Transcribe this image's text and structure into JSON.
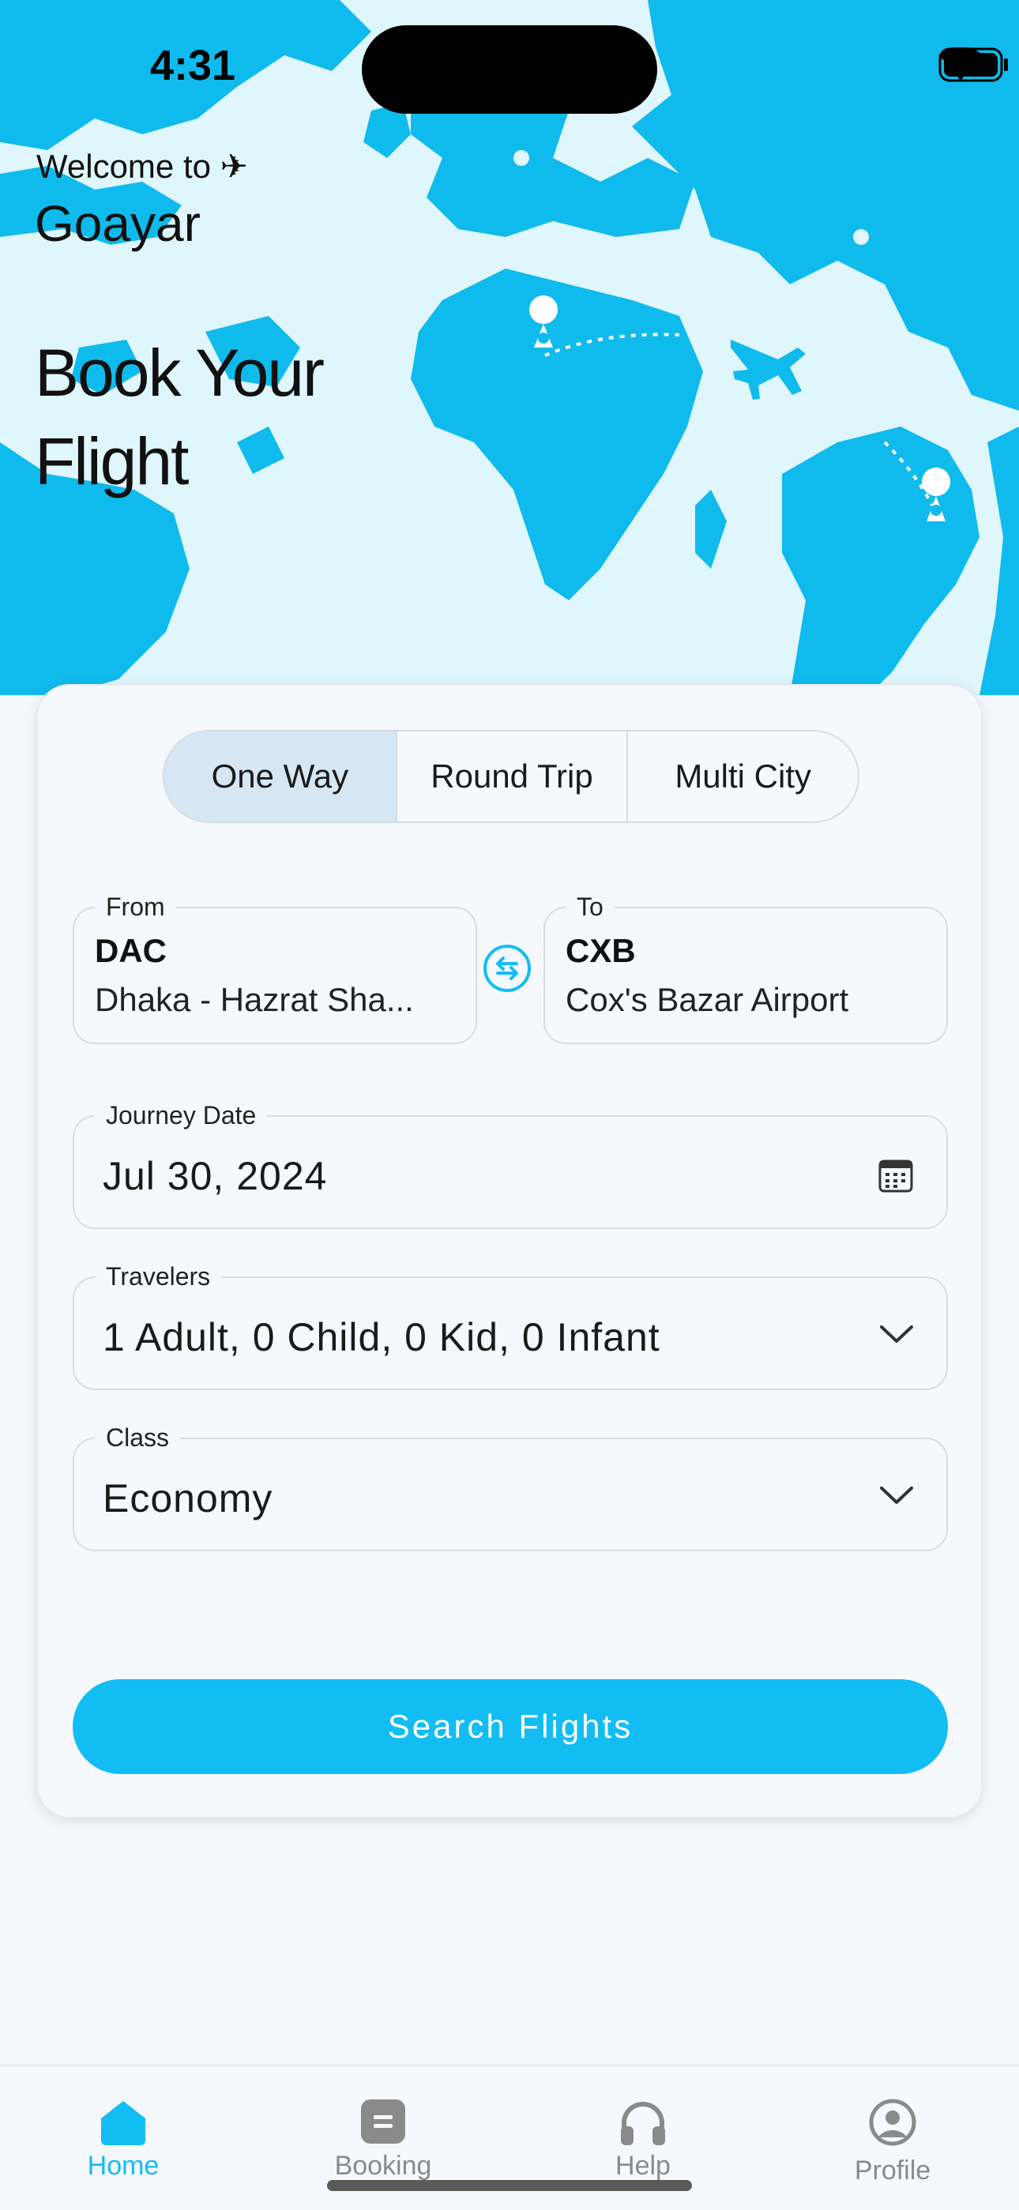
{
  "status_bar": {
    "time": "4:31"
  },
  "hero": {
    "welcome": "Welcome to ✈",
    "brand": "Goayar",
    "headline": "Book Your Flight"
  },
  "trip_types": {
    "options": [
      "One Way",
      "Round Trip",
      "Multi City"
    ],
    "selected": "One Way"
  },
  "from": {
    "label": "From",
    "code": "DAC",
    "name": "Dhaka - Hazrat Sha..."
  },
  "to": {
    "label": "To",
    "code": "CXB",
    "name": "Cox's Bazar Airport"
  },
  "journey_date": {
    "label": "Journey Date",
    "value": "Jul 30, 2024"
  },
  "travelers": {
    "label": "Travelers",
    "value": "1 Adult, 0 Child, 0 Kid, 0 Infant"
  },
  "travel_class": {
    "label": "Class",
    "value": "Economy"
  },
  "search_button": {
    "label": "Search Flights"
  },
  "tab_bar": {
    "items": [
      {
        "label": "Home",
        "icon": "home-icon",
        "active": true
      },
      {
        "label": "Booking",
        "icon": "booking-icon",
        "active": false
      },
      {
        "label": "Help",
        "icon": "headphones-icon",
        "active": false
      },
      {
        "label": "Profile",
        "icon": "profile-icon",
        "active": false
      }
    ]
  },
  "colors": {
    "accent": "#12bdf3",
    "map_land": "#0fbbec",
    "hero_bg": "#dff6fd",
    "segment_active": "#d6e6f3",
    "page_bg": "#f4f8fd"
  }
}
